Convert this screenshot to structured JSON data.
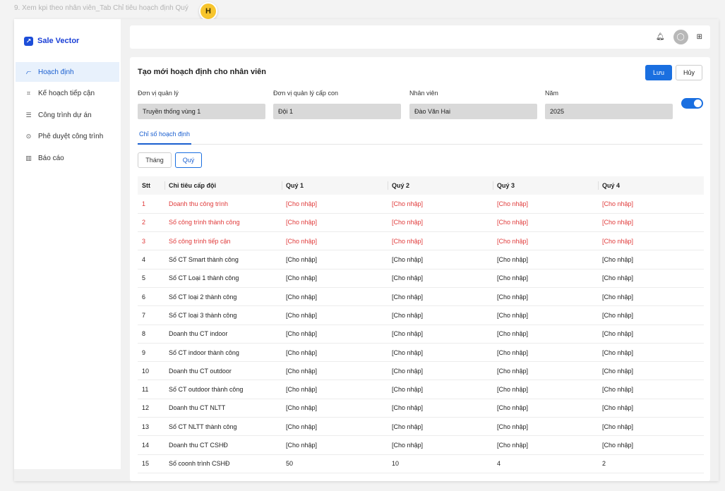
{
  "caption": "9. Xem kpi theo nhân viên_Tab Chỉ tiêu hoạch định Quý",
  "avatar_badge": "H",
  "brand": {
    "name": "Sale Vector"
  },
  "sidebar": {
    "items": [
      {
        "label": "Hoạch định",
        "icon": "chart-icon",
        "active": true
      },
      {
        "label": "Kế hoạch tiếp cận",
        "icon": "link-icon",
        "active": false
      },
      {
        "label": "Công trình dự án",
        "icon": "list-icon",
        "active": false
      },
      {
        "label": "Phê duyệt công trình",
        "icon": "check-circle-icon",
        "active": false
      },
      {
        "label": "Báo cáo",
        "icon": "bar-chart-icon",
        "active": false
      }
    ]
  },
  "topbar": {
    "icons": [
      "bell-icon",
      "user-avatar",
      "grid-icon"
    ]
  },
  "form": {
    "title": "Tạo mới hoạch định cho nhân viên",
    "save_label": "Lưu",
    "cancel_label": "Hủy",
    "fields": [
      {
        "label": "Đơn vị quản lý",
        "value": "Truyền thống vùng 1"
      },
      {
        "label": "Đơn vị quản lý cấp con",
        "value": "Đội 1"
      },
      {
        "label": "Nhân viên",
        "value": "Đào Văn Hai"
      },
      {
        "label": "Năm",
        "value": "2025"
      }
    ],
    "toggle_on": true
  },
  "tabs": {
    "active": "Chỉ số hoạch định"
  },
  "period": {
    "month": "Tháng",
    "quarter": "Quý",
    "selected": "Quý"
  },
  "colors": {
    "accent": "#1a6fe0",
    "highlight_text": "#e03a3a"
  },
  "table": {
    "headers": [
      "Stt",
      "Chỉ tiêu cấp đội",
      "Quý 1",
      "Quý 2",
      "Quý 3",
      "Quý 4"
    ],
    "rows": [
      {
        "stt": "1",
        "name": "Doanh thu công trình",
        "q1": "[Cho nhập]",
        "q2": "[Cho nhập]",
        "q3": "[Cho nhập]",
        "q4": "[Cho nhập]",
        "highlight": true
      },
      {
        "stt": "2",
        "name": "Số công trình thành công",
        "q1": "[Cho nhập]",
        "q2": "[Cho nhập]",
        "q3": "[Cho nhập]",
        "q4": "[Cho nhập]",
        "highlight": true
      },
      {
        "stt": "3",
        "name": "Số công trình tiếp cận",
        "q1": "[Cho nhập]",
        "q2": "[Cho nhập]",
        "q3": "[Cho nhập]",
        "q4": "[Cho nhập]",
        "highlight": true
      },
      {
        "stt": "4",
        "name": "Số CT Smart thành công",
        "q1": "[Cho nhập]",
        "q2": "[Cho nhập]",
        "q3": "[Cho nhập]",
        "q4": "[Cho nhập]",
        "highlight": false
      },
      {
        "stt": "5",
        "name": "Số CT Loại 1 thành công",
        "q1": "[Cho nhập]",
        "q2": "[Cho nhập]",
        "q3": "[Cho nhập]",
        "q4": "[Cho nhập]",
        "highlight": false
      },
      {
        "stt": "6",
        "name": "Số CT loại 2 thành công",
        "q1": "[Cho nhập]",
        "q2": "[Cho nhập]",
        "q3": "[Cho nhập]",
        "q4": "[Cho nhập]",
        "highlight": false
      },
      {
        "stt": "7",
        "name": "Số CT loại 3 thành công",
        "q1": "[Cho nhập]",
        "q2": "[Cho nhập]",
        "q3": "[Cho nhập]",
        "q4": "[Cho nhập]",
        "highlight": false
      },
      {
        "stt": "8",
        "name": "Doanh thu CT indoor",
        "q1": "[Cho nhập]",
        "q2": "[Cho nhập]",
        "q3": "[Cho nhập]",
        "q4": "[Cho nhập]",
        "highlight": false
      },
      {
        "stt": "9",
        "name": "Số CT indoor thành công",
        "q1": "[Cho nhập]",
        "q2": "[Cho nhập]",
        "q3": "[Cho nhập]",
        "q4": "[Cho nhập]",
        "highlight": false
      },
      {
        "stt": "10",
        "name": "Doanh thu CT outdoor",
        "q1": "[Cho nhập]",
        "q2": "[Cho nhập]",
        "q3": "[Cho nhập]",
        "q4": "[Cho nhập]",
        "highlight": false
      },
      {
        "stt": "11",
        "name": "Số CT outdoor thành công",
        "q1": "[Cho nhập]",
        "q2": "[Cho nhập]",
        "q3": "[Cho nhập]",
        "q4": "[Cho nhập]",
        "highlight": false
      },
      {
        "stt": "12",
        "name": "Doanh thu CT NLTT",
        "q1": "[Cho nhập]",
        "q2": "[Cho nhập]",
        "q3": "[Cho nhập]",
        "q4": "[Cho nhập]",
        "highlight": false
      },
      {
        "stt": "13",
        "name": "Số CT NLTT thành công",
        "q1": "[Cho nhập]",
        "q2": "[Cho nhập]",
        "q3": "[Cho nhập]",
        "q4": "[Cho nhập]",
        "highlight": false
      },
      {
        "stt": "14",
        "name": "Doanh thu CT CSHĐ",
        "q1": "[Cho nhập]",
        "q2": "[Cho nhập]",
        "q3": "[Cho nhập]",
        "q4": "[Cho nhập]",
        "highlight": false
      },
      {
        "stt": "15",
        "name": "Số coonh trình CSHĐ",
        "q1": "50",
        "q2": "10",
        "q3": "4",
        "q4": "2",
        "highlight": false
      }
    ]
  }
}
